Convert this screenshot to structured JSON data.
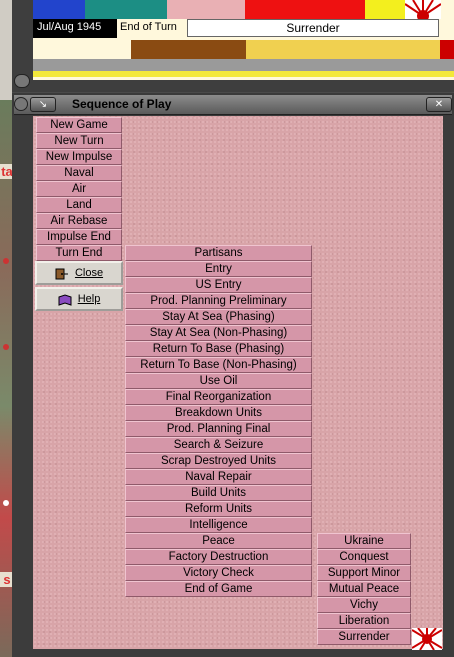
{
  "status": {
    "date": "Jul/Aug 1945",
    "phase_label": "End of Turn",
    "surrender_text": "Surrender"
  },
  "dialog": {
    "title": "Sequence of Play",
    "close_label": "Close",
    "help_label": "Help"
  },
  "phases": [
    "New Game",
    "New Turn",
    "New Impulse",
    "Naval",
    "Air",
    "Land",
    "Air Rebase",
    "Impulse End",
    "Turn End"
  ],
  "turn_end_steps": [
    "Partisans",
    "Entry",
    "US Entry",
    "Prod. Planning Preliminary",
    "Stay At Sea (Phasing)",
    "Stay At Sea (Non-Phasing)",
    "Return To Base (Phasing)",
    "Return To Base (Non-Phasing)",
    "Use Oil",
    "Final Reorganization",
    "Breakdown Units",
    "Prod. Planning Final",
    "Search & Seizure",
    "Scrap Destroyed Units",
    "Naval Repair",
    "Build Units",
    "Reform Units",
    "Intelligence",
    "Peace",
    "Factory Destruction",
    "Victory Check",
    "End of Game"
  ],
  "peace_steps": [
    "Ukraine",
    "Conquest",
    "Support Minor",
    "Mutual Peace",
    "Vichy",
    "Liberation",
    "Surrender"
  ],
  "map_letters": {
    "a": "ta",
    "b": "s"
  },
  "colors": {
    "item_bg": "#d596a8",
    "panel_bg": "#d8a4a8",
    "title_bar": "#6e6e6e",
    "japan_red": "#cc0000"
  }
}
